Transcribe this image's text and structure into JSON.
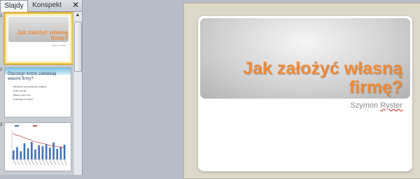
{
  "tabs": {
    "slides": "Slajdy",
    "outline": "Konspekt",
    "close": "✕"
  },
  "thumbs": [
    {
      "num": "1",
      "title": "Jak założyć własną firmę?",
      "sub": "Szymon Ryster"
    },
    {
      "num": "2",
      "title": "Dlaczego ludzie zakładają własne firmy?",
      "bullets": [
        "Możliwość samodzielnego działania",
        "Dobre zarobki",
        "Własny czas pracy",
        "Realizacja pomysłów"
      ]
    },
    {
      "num": "3"
    }
  ],
  "slide": {
    "title": "Jak założyć własną firmę?",
    "subtitle_first": "Szymon",
    "subtitle_last": "Ryster"
  },
  "chart_data": {
    "type": "bar",
    "values": [
      30,
      42,
      28,
      55,
      38,
      60,
      34,
      48,
      45,
      52,
      40,
      58,
      36,
      44,
      50
    ],
    "line": [
      88,
      82,
      80,
      74,
      70,
      66,
      60,
      58,
      55,
      52,
      48,
      46,
      44,
      42,
      40
    ],
    "colors": {
      "bar": "#3f6fb6",
      "line": "#c0504d"
    }
  }
}
